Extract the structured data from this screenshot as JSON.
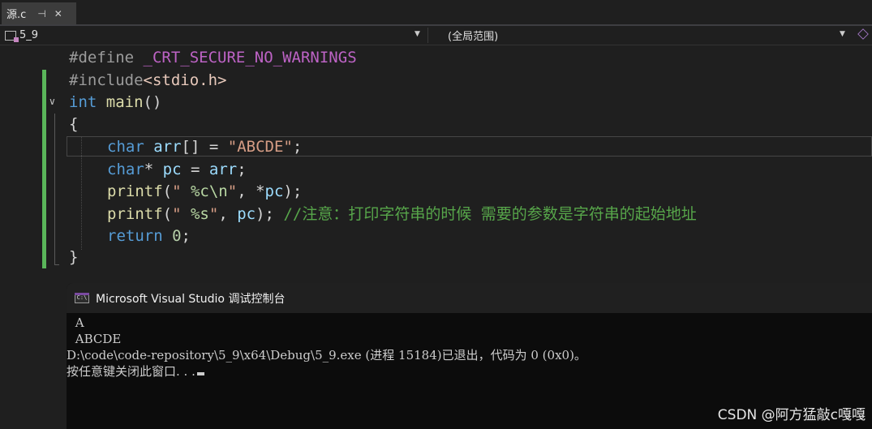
{
  "tab": {
    "name": "源.c",
    "pin_glyph": "⊣",
    "close_glyph": "✕"
  },
  "navbar": {
    "project": "5_9",
    "scope": "(全局范围)"
  },
  "code": {
    "line1": {
      "keyword": "#define",
      "macro": "_CRT_SECURE_NO_WARNINGS"
    },
    "line2": {
      "keyword": "#include",
      "header": "<stdio.h>"
    },
    "line3": {
      "type": "int",
      "name": "main",
      "parens": "()"
    },
    "line4": {
      "brace": "{"
    },
    "line5": {
      "type": "char",
      "rest1": " ",
      "var": "arr",
      "rest2": "[] = ",
      "str": "\"ABCDE\"",
      "end": ";"
    },
    "line6": {
      "type": "char",
      "rest1": "* ",
      "var1": "pc",
      "rest2": " = ",
      "var2": "arr",
      "end": ";"
    },
    "line7": {
      "fn": "printf",
      "open": "(",
      "str1": "\" ",
      "fmt": "%c\\n",
      "str2": "\"",
      "mid": ", *",
      "var": "pc",
      "end": ");"
    },
    "line8": {
      "fn": "printf",
      "open": "(",
      "str1": "\" ",
      "fmt": "%s",
      "str2": "\"",
      "mid": ", ",
      "var": "pc",
      "end": "); ",
      "comment": "//注意：打印字符串的时候 需要的参数是字符串的起始地址"
    },
    "line9": {
      "kw": "return",
      "num": " 0",
      "end": ";"
    },
    "line10": {
      "brace": "}"
    }
  },
  "console": {
    "title": "Microsoft Visual Studio 调试控制台",
    "icon_text": "C:\\",
    "lines": [
      " A",
      " ABCDE",
      "D:\\code\\code-repository\\5_9\\x64\\Debug\\5_9.exe (进程 15184)已退出，代码为 0 (0x0)。",
      "按任意键关闭此窗口. . ."
    ]
  },
  "watermark": "CSDN @阿方猛敲c嘎嘎",
  "colors": {
    "editor_bg": "#1f1f1f",
    "keyword_blue": "#569cd6",
    "function_yellow": "#dcdcaa",
    "variable_cyan": "#9cdcfe",
    "string": "#e8c9bb",
    "comment_green": "#57a64a",
    "macro_purple": "#bd63c5",
    "change_bar_green": "#5ab65a",
    "console_bg": "#0c0c0c"
  }
}
